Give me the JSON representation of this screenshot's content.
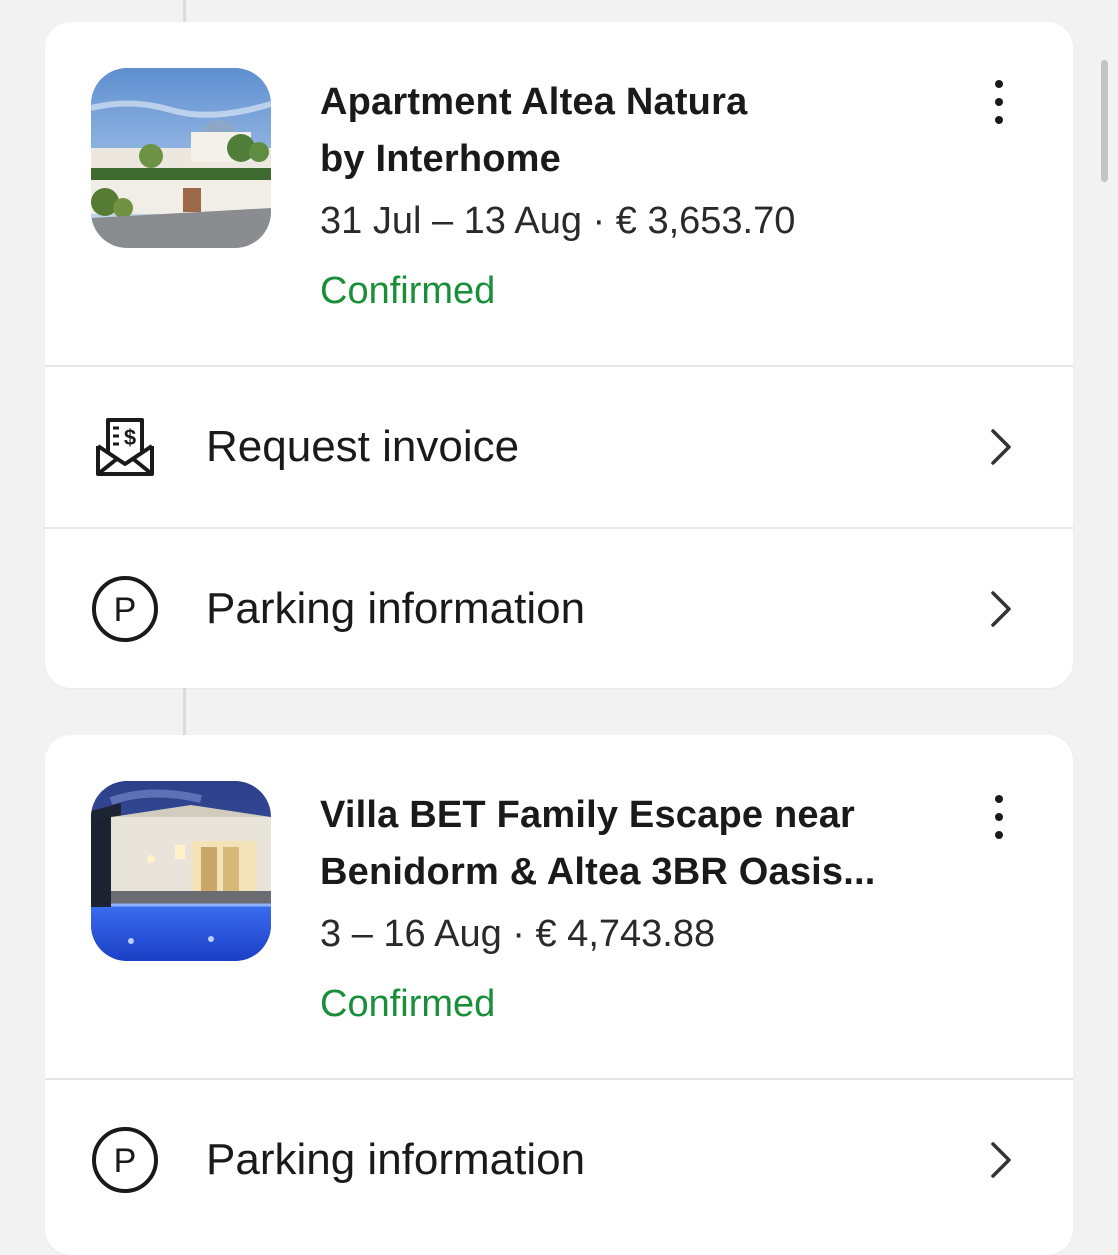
{
  "bookings": [
    {
      "title_line1": "Apartment Altea Natura",
      "title_line2": "by Interhome",
      "dates_price": "31 Jul – 13 Aug · € 3,653.70",
      "status": "Confirmed",
      "actions": [
        {
          "label": "Request invoice",
          "icon": "invoice-envelope-icon"
        },
        {
          "label": "Parking information",
          "icon": "parking-icon"
        }
      ]
    },
    {
      "title_line1": "Villa BET Family Escape near",
      "title_line2": "Benidorm & Altea 3BR Oasis...",
      "dates_price": "3 – 16 Aug · € 4,743.88",
      "status": "Confirmed",
      "actions": [
        {
          "label": "Parking information",
          "icon": "parking-icon"
        }
      ]
    }
  ],
  "colors": {
    "status_confirmed": "#1a8f3a",
    "background": "#f2f2f2",
    "card": "#ffffff"
  }
}
